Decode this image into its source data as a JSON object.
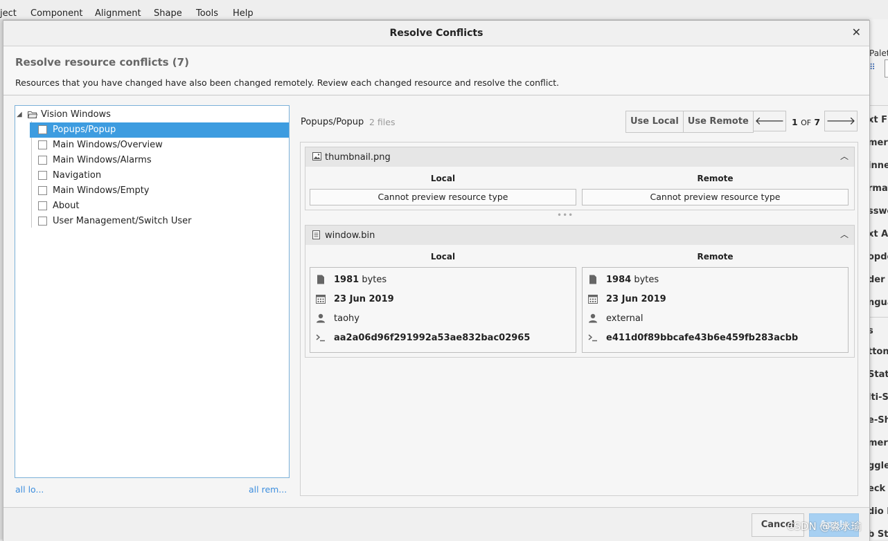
{
  "menubar": {
    "items": [
      "ject",
      "Component",
      "Alignment",
      "Shape",
      "Tools",
      "Help"
    ]
  },
  "right_panel": {
    "palette": "Palett",
    "items": [
      "xt Fi",
      "mer",
      "inne",
      "rmat",
      "sswo",
      "xt Ar",
      "opdc",
      "der",
      "ngua",
      "s",
      "tton",
      "State",
      "lti-S",
      "e-Sh",
      "mer",
      "ggle",
      "eck",
      "dio E",
      "b St"
    ]
  },
  "dialog": {
    "title": "Resolve Conflicts",
    "close_glyph": "✕",
    "heading": "Resolve resource conflicts (7)",
    "description": "Resources that you have changed have also been changed remotely. Review each changed resource and resolve the conflict."
  },
  "tree": {
    "root": "Vision Windows",
    "items": [
      {
        "label": "Popups/Popup",
        "selected": true
      },
      {
        "label": "Main Windows/Overview",
        "selected": false
      },
      {
        "label": "Main Windows/Alarms",
        "selected": false
      },
      {
        "label": "Navigation",
        "selected": false
      },
      {
        "label": "Main Windows/Empty",
        "selected": false
      },
      {
        "label": "About",
        "selected": false
      },
      {
        "label": "User Management/Switch User",
        "selected": false
      }
    ]
  },
  "links": {
    "all_local": "all lo...",
    "all_remote": "all rem..."
  },
  "detail": {
    "path": "Popups/Popup",
    "files_count": "2 files",
    "use_local": "Use Local",
    "use_remote": "Use Remote",
    "prev_glyph": "🡐",
    "next_glyph": "🡒",
    "page_current": "1",
    "page_of": "OF",
    "page_total": "7"
  },
  "files": [
    {
      "name": "thumbnail.png",
      "icon": "image-icon",
      "local_title": "Local",
      "remote_title": "Remote",
      "local_preview": "Cannot preview resource type",
      "remote_preview": "Cannot preview resource type"
    },
    {
      "name": "window.bin",
      "icon": "file-icon",
      "local_title": "Local",
      "remote_title": "Remote",
      "local": {
        "size": "1981",
        "size_unit": "bytes",
        "date": "23 Jun 2019",
        "user": "taohy",
        "hash": "aa2a06d96f291992a53ae832bac02965"
      },
      "remote": {
        "size": "1984",
        "size_unit": "bytes",
        "date": "23 Jun 2019",
        "user": "external",
        "hash": "e411d0f89bbcafe43b6e459fb283acbb"
      }
    }
  ],
  "footer": {
    "cancel": "Cancel",
    "apply": "Apply"
  },
  "watermark": "CSDN @淼水瑜",
  "colors": {
    "selection": "#3d9ce0",
    "link": "#3d8ede",
    "apply_disabled": "#a7d0f2"
  }
}
